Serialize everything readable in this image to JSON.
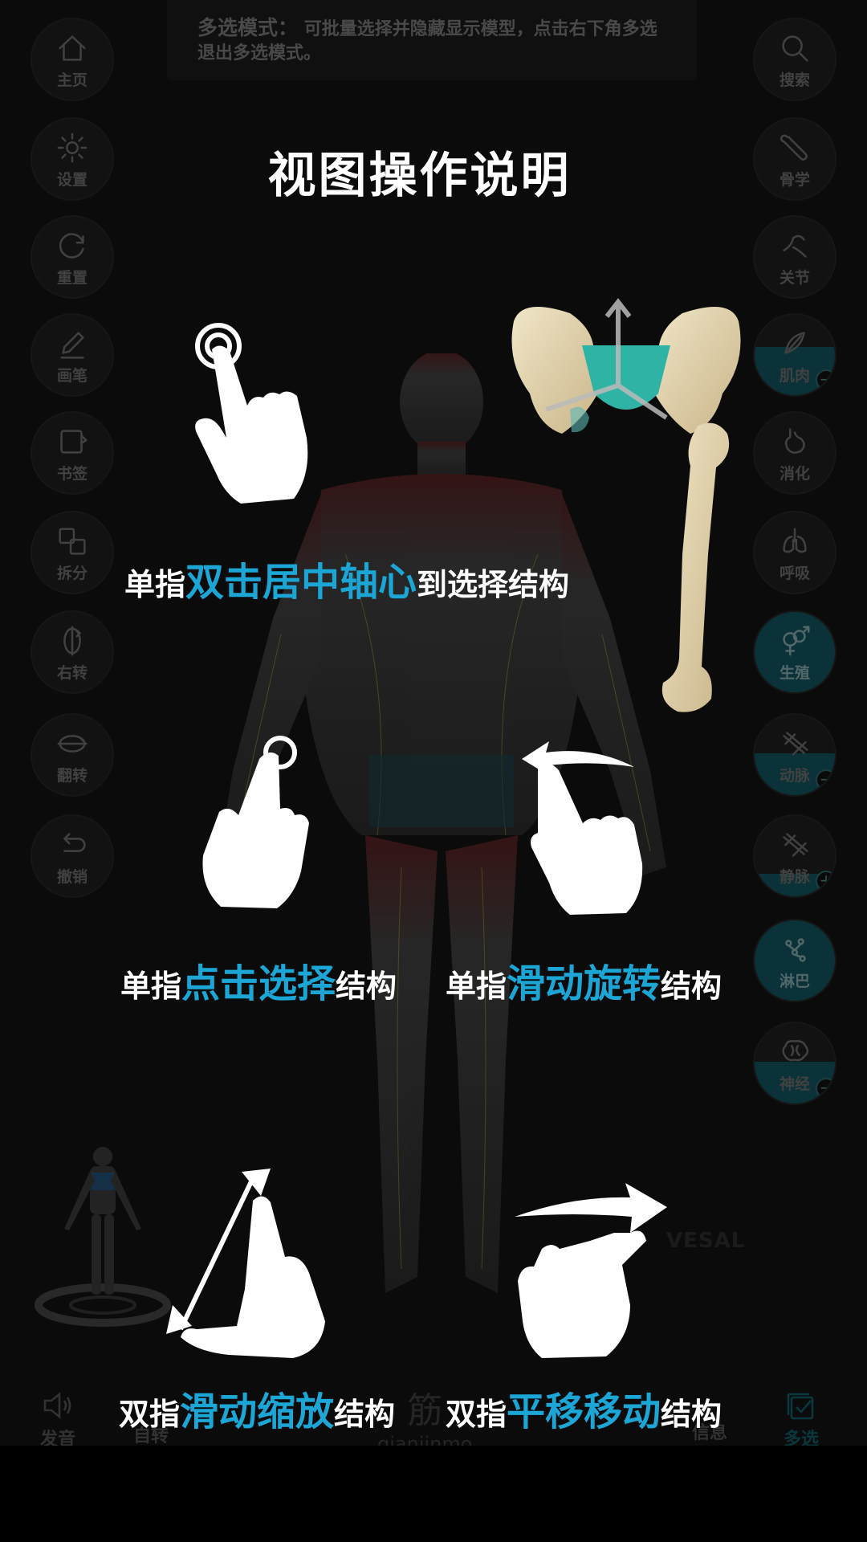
{
  "hint_banner": {
    "lead": "多选模式：",
    "text": "可批量选择并隐藏显示模型，点击右下角多选退出多选模式。"
  },
  "left_sidebar": [
    {
      "label": "主页",
      "icon": "home-icon"
    },
    {
      "label": "设置",
      "icon": "gear-icon"
    },
    {
      "label": "重置",
      "icon": "reset-icon"
    },
    {
      "label": "画笔",
      "icon": "pen-icon"
    },
    {
      "label": "书签",
      "icon": "bookmark-icon"
    },
    {
      "label": "拆分",
      "icon": "split-icon"
    },
    {
      "label": "右转",
      "icon": "rotate-right-icon"
    },
    {
      "label": "翻转",
      "icon": "flip-icon"
    },
    {
      "label": "撤销",
      "icon": "undo-icon"
    }
  ],
  "right_sidebar": [
    {
      "label": "搜索",
      "icon": "search-icon"
    },
    {
      "label": "骨学",
      "icon": "bone-icon"
    },
    {
      "label": "关节",
      "icon": "joint-icon"
    },
    {
      "label": "肌肉",
      "icon": "muscle-icon",
      "badge": "−"
    },
    {
      "label": "消化",
      "icon": "stomach-icon"
    },
    {
      "label": "呼吸",
      "icon": "lungs-icon"
    },
    {
      "label": "生殖",
      "icon": "reproductive-icon"
    },
    {
      "label": "动脉",
      "icon": "artery-icon",
      "badge": "−"
    },
    {
      "label": "静脉",
      "icon": "vein-icon",
      "badge": "+"
    },
    {
      "label": "淋巴",
      "icon": "lymph-icon"
    },
    {
      "label": "神经",
      "icon": "brain-icon",
      "badge": "−"
    }
  ],
  "bottom_bar": {
    "sound_label": "发音",
    "rotate_label": "自转",
    "info_label": "信息",
    "multiselect_label": "多选",
    "brand_text": "筋",
    "brand_pinyin": "qianjinmo"
  },
  "watermark": "VESAL",
  "overlay": {
    "title": "视图操作说明",
    "captions": {
      "double_tap": {
        "pre": "单指",
        "hl": "双击居中轴心",
        "post": "到选择结构"
      },
      "tap": {
        "pre": "单指",
        "hl": "点击选择",
        "post": "结构"
      },
      "swipe": {
        "pre": "单指",
        "hl": "滑动旋转",
        "post": "结构"
      },
      "pinch": {
        "pre": "双指",
        "hl": "滑动缩放",
        "post": "结构"
      },
      "pan": {
        "pre": "双指",
        "hl": "平移移动",
        "post": "结构"
      }
    }
  },
  "colors": {
    "accent_blue": "#1ba6d6",
    "teal": "#0b5560"
  }
}
